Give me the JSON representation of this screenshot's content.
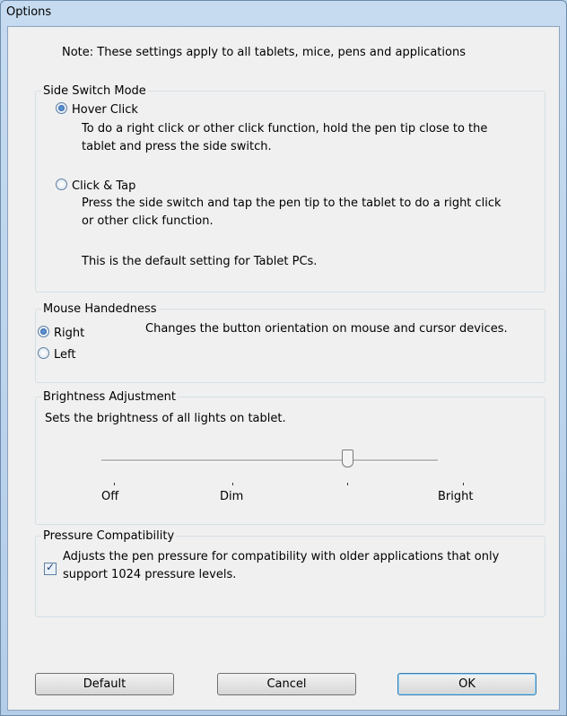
{
  "window": {
    "title": "Options"
  },
  "note": "Note: These settings apply to all tablets, mice, pens and applications",
  "side_switch": {
    "legend": "Side Switch Mode",
    "hover": {
      "label": "Hover Click",
      "selected": true,
      "desc_line1": "To do a right click or other click function, hold the pen tip close to the",
      "desc_line2": "tablet and press the side switch."
    },
    "tap": {
      "label": "Click & Tap",
      "selected": false,
      "desc_line1": "Press the side switch and tap the pen tip to the tablet to do a right click",
      "desc_line2": "or other click function.",
      "default_note": "This is the default setting for Tablet PCs."
    }
  },
  "handedness": {
    "legend": "Mouse Handedness",
    "right": {
      "label": "Right",
      "selected": true
    },
    "left": {
      "label": "Left",
      "selected": false
    },
    "desc": "Changes the button orientation on mouse and cursor devices."
  },
  "brightness": {
    "legend": "Brightness Adjustment",
    "desc": "Sets the brightness of all lights on tablet.",
    "labels": {
      "off": "Off",
      "dim": "Dim",
      "bright": "Bright"
    },
    "level": 0.73
  },
  "pressure": {
    "legend": "Pressure Compatibility",
    "checked": true,
    "desc_line1": "Adjusts the pen pressure for compatibility with older applications that only",
    "desc_line2": "support 1024 pressure levels."
  },
  "buttons": {
    "default": "Default",
    "cancel": "Cancel",
    "ok": "OK"
  }
}
